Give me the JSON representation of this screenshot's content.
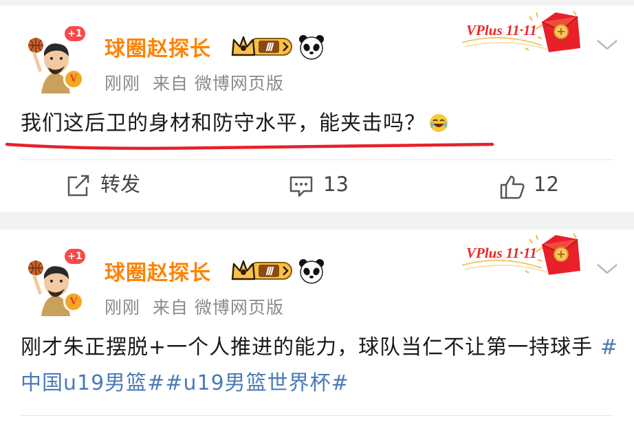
{
  "posts": [
    {
      "avatar_badge": "+1",
      "verified_badge": "V",
      "username": "球圈赵探长",
      "level_badge": "Ⅲ",
      "timestamp": "刚刚",
      "source": "来自 微博网页版",
      "promo": "VPlus 11·11",
      "content": "我们这后卫的身材和防守水平，能夹击吗？",
      "content_emoji": "laugh-cry-emoji",
      "actions": {
        "repost_label": "转发",
        "comment_count": "13",
        "like_count": "12"
      }
    },
    {
      "avatar_badge": "+1",
      "verified_badge": "V",
      "username": "球圈赵探长",
      "level_badge": "Ⅲ",
      "timestamp": "刚刚",
      "source": "来自 微博网页版",
      "promo": "VPlus 11·11",
      "content": "刚才朱正摆脱+一个人推进的能力，球队当仁不让第一持球手 ",
      "topics": [
        "#中国u19男篮#",
        "#u19男篮世界杯#"
      ]
    }
  ],
  "colors": {
    "username": "#ff8200",
    "topic": "#4a7ab8",
    "underline": "#e8202a",
    "meta": "#8a8a8a",
    "background": "#f2f2f2"
  },
  "icons": [
    "basketball-player-avatar",
    "crown-level-badge",
    "panda-icon",
    "red-envelope-icon",
    "chevron-down-icon",
    "share-icon",
    "comment-icon",
    "thumbs-up-icon"
  ]
}
